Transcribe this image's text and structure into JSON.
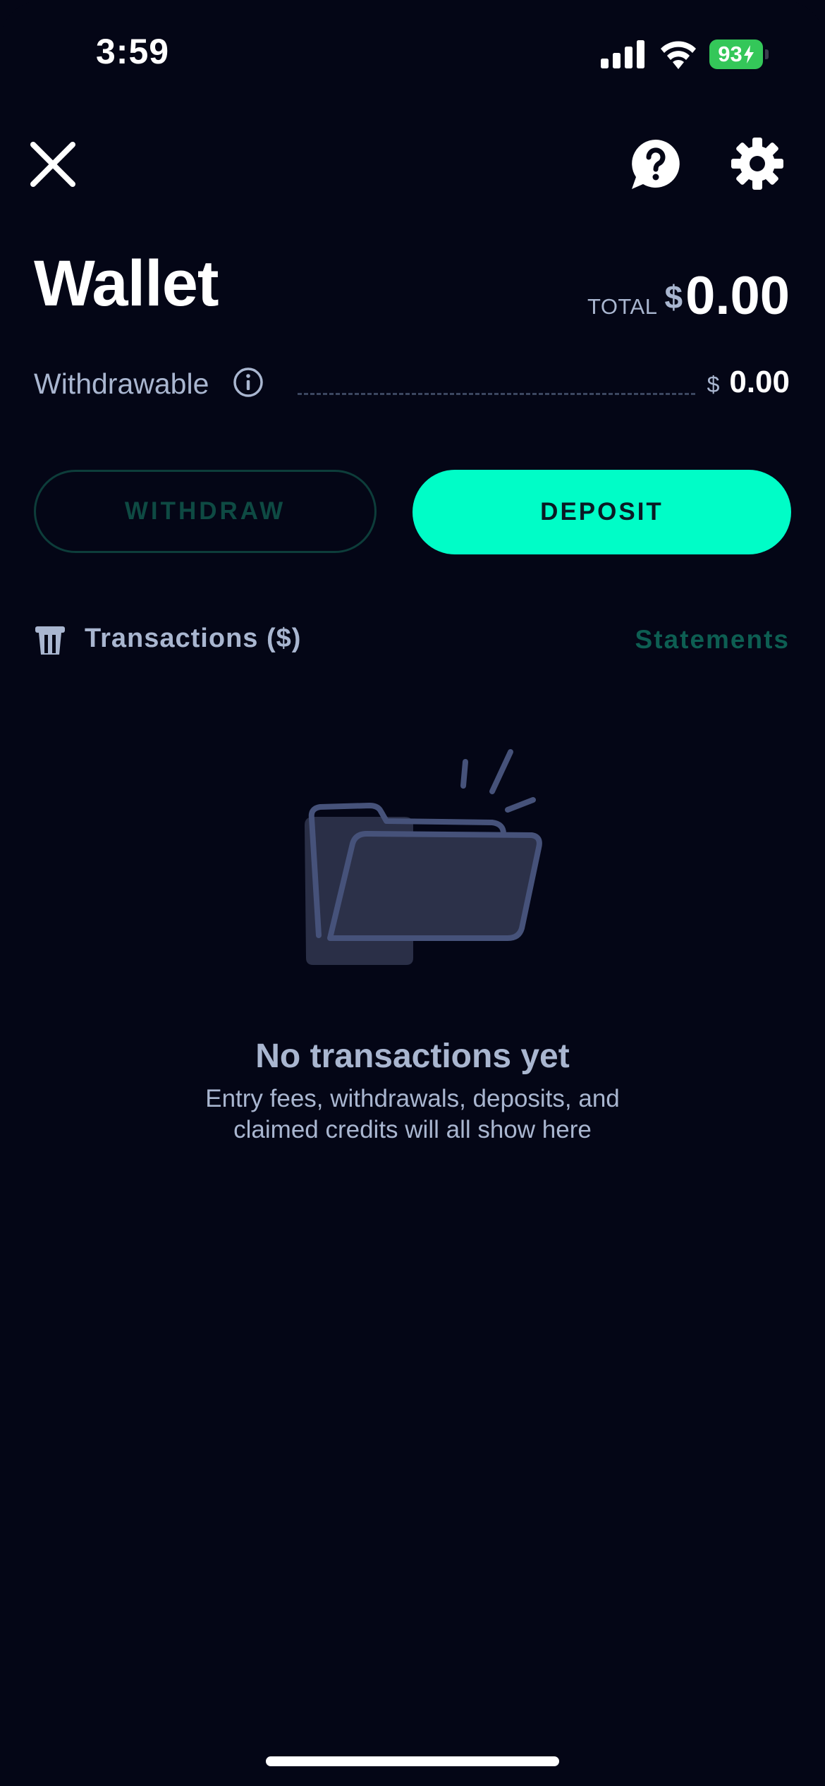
{
  "status_bar": {
    "time": "3:59",
    "battery_percent": "93"
  },
  "header": {
    "title": "Wallet",
    "total_label": "TOTAL",
    "total_currency": "$",
    "total_amount": "0.00"
  },
  "withdrawable": {
    "label": "Withdrawable",
    "currency": "$",
    "amount": "0.00"
  },
  "actions": {
    "withdraw_label": "WITHDRAW",
    "deposit_label": "DEPOSIT"
  },
  "transactions": {
    "label": "Transactions ($)",
    "statements_label": "Statements"
  },
  "empty_state": {
    "title": "No transactions yet",
    "subtitle": "Entry fees, withdrawals, deposits, and claimed credits will all show here"
  },
  "colors": {
    "background": "#040616",
    "accent": "#00fdc7",
    "muted_text": "#a9b6d0",
    "battery": "#34c759"
  },
  "icons": {
    "close": "close-icon",
    "help": "help-icon",
    "settings": "gear-icon",
    "info": "info-icon",
    "transactions": "transactions-icon",
    "empty": "empty-folder-icon"
  }
}
